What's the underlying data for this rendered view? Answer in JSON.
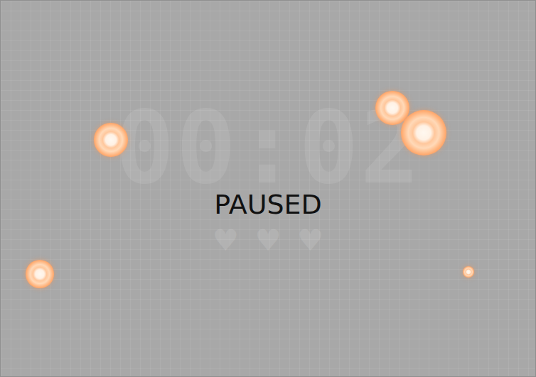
{
  "game": {
    "timer": "00:02",
    "status": "PAUSED"
  },
  "hearts": [
    {
      "icon": "♥"
    },
    {
      "icon": "♥"
    },
    {
      "icon": "♥"
    }
  ]
}
